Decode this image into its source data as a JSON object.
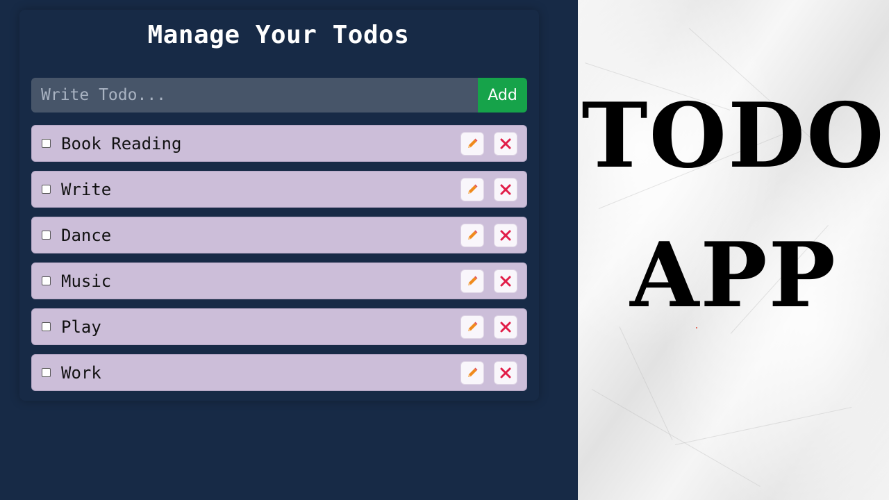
{
  "app": {
    "title": "Manage Your Todos"
  },
  "form": {
    "placeholder": "Write Todo...",
    "value": "",
    "add_label": "Add"
  },
  "todos": [
    {
      "text": "Book Reading",
      "done": false
    },
    {
      "text": "Write",
      "done": false
    },
    {
      "text": "Dance",
      "done": false
    },
    {
      "text": "Music",
      "done": false
    },
    {
      "text": "Play",
      "done": false
    },
    {
      "text": "Work",
      "done": false
    }
  ],
  "icons": {
    "edit": "pencil-icon",
    "delete": "close-icon"
  },
  "colors": {
    "background": "#172a46",
    "input_bg": "#475569",
    "add_button": "#16a34a",
    "todo_bg": "#ccbed9",
    "edit_icon": "#f08a1c",
    "delete_icon": "#e11d48"
  },
  "banner": {
    "line1": "TODO",
    "line2": "APP"
  }
}
